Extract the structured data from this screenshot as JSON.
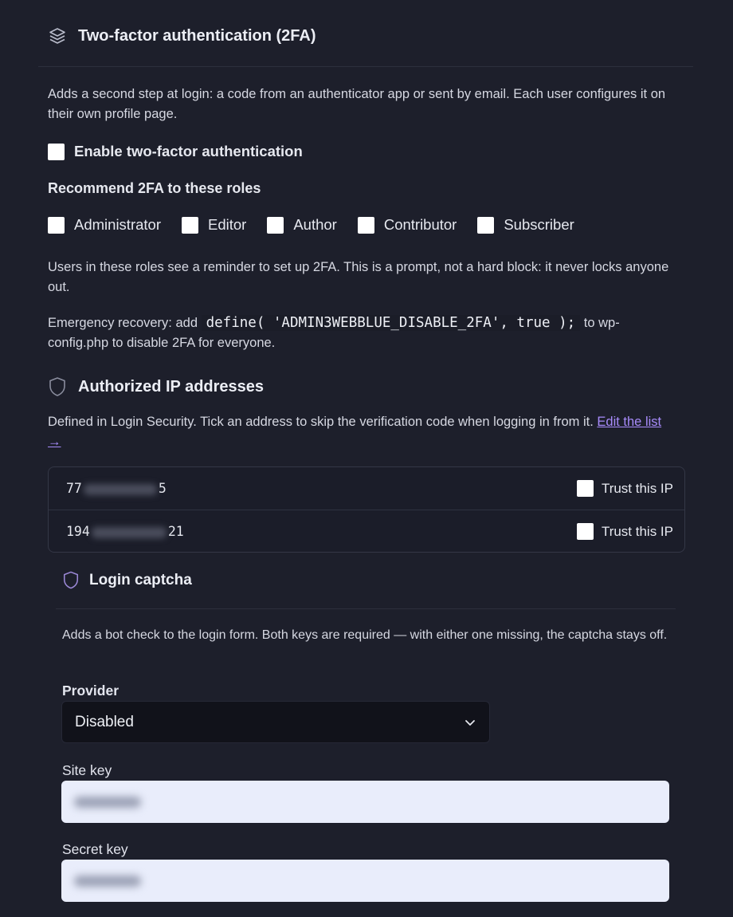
{
  "twofa": {
    "title": "Two-factor authentication (2FA)",
    "description": "Adds a second step at login: a code from an authenticator app or sent by email. Each user configures it on their own profile page.",
    "enable_label": "Enable two-factor authentication",
    "roles_heading": "Recommend 2FA to these roles",
    "roles": [
      {
        "label": "Administrator"
      },
      {
        "label": "Editor"
      },
      {
        "label": "Author"
      },
      {
        "label": "Contributor"
      },
      {
        "label": "Subscriber"
      }
    ],
    "roles_note": "Users in these roles see a reminder to set up 2FA. This is a prompt, not a hard block: it never locks anyone out.",
    "recovery_prefix": "Emergency recovery: add",
    "recovery_code": "define( 'ADMIN3WEBBLUE_DISABLE_2FA', true );",
    "recovery_suffix": "to wp-config.php to disable 2FA for everyone."
  },
  "authorized_ips": {
    "title": "Authorized IP addresses",
    "description": "Defined in Login Security. Tick an address to skip the verification code when logging in from it.",
    "edit_link": "Edit the list →",
    "rows": [
      {
        "ip_start": "77",
        "ip_end": "5",
        "trust_label": "Trust this IP"
      },
      {
        "ip_start": "194",
        "ip_end": "21",
        "trust_label": "Trust this IP"
      }
    ]
  },
  "captcha": {
    "title": "Login captcha",
    "description": "Adds a bot check to the login form. Both keys are required — with either one missing, the captcha stays off.",
    "provider_label": "Provider",
    "provider_value": "Disabled",
    "site_key_label": "Site key",
    "secret_key_label": "Secret key"
  },
  "colors": {
    "background": "#1d1f2b",
    "accent": "#a78bfa"
  }
}
